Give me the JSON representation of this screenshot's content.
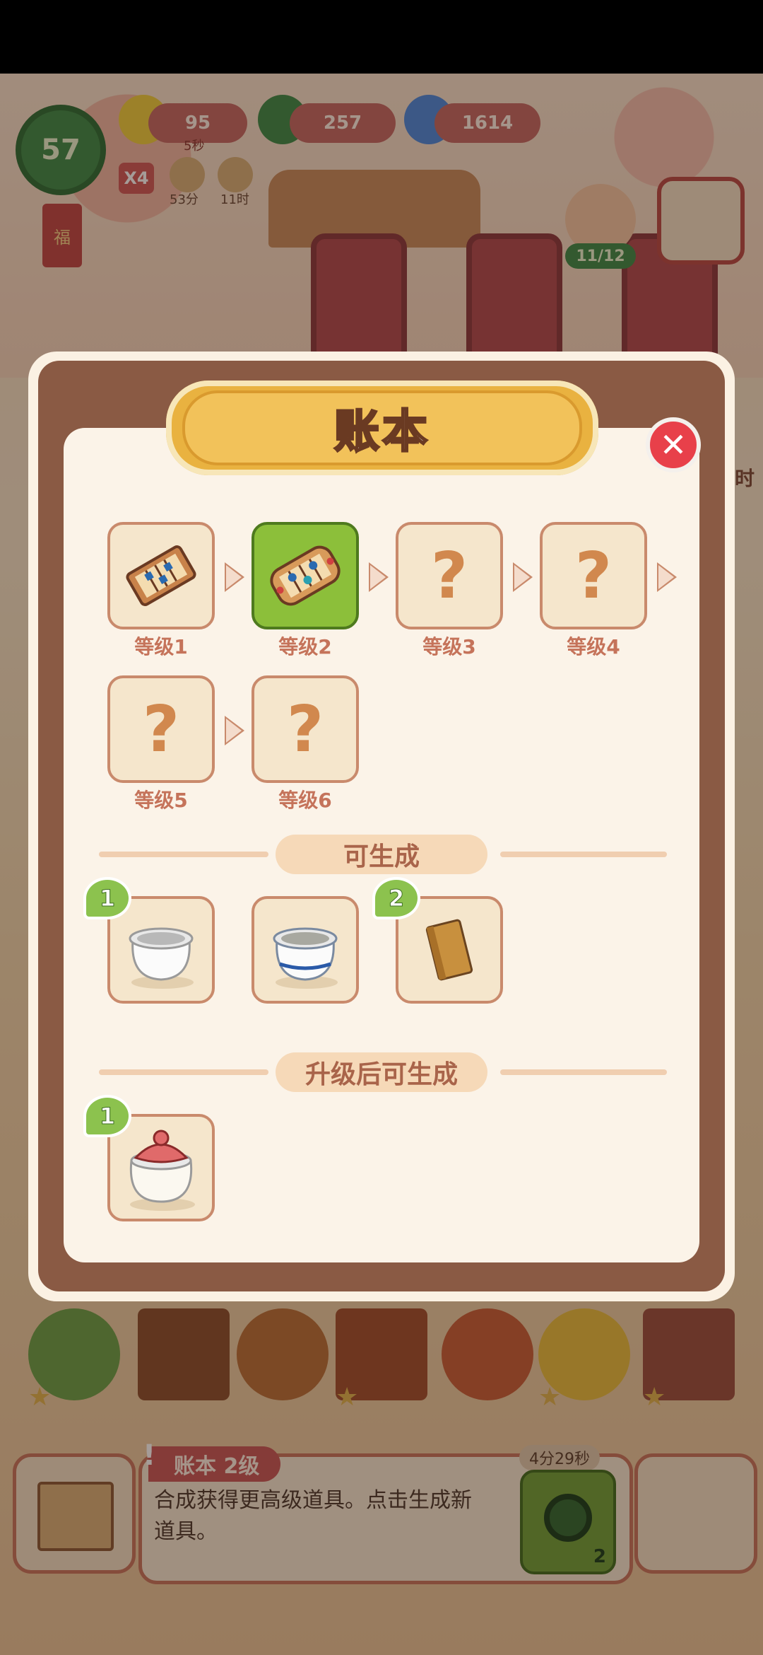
{
  "hud": {
    "player_level": "57",
    "energy": "95",
    "energy_timer": "5秒",
    "coins": "257",
    "gems": "1614",
    "multiplier": "X4",
    "timer_a": "53分",
    "timer_b": "11时",
    "npc_progress": "11/12",
    "side_clock": "时"
  },
  "dialog": {
    "title": "账本",
    "close_icon": "close-x-icon",
    "levels": [
      {
        "label": "等级1",
        "state": "unlocked",
        "icon": "abacus-icon"
      },
      {
        "label": "等级2",
        "state": "current",
        "icon": "abacus-icon"
      },
      {
        "label": "等级3",
        "state": "locked",
        "icon": "question-mark-icon",
        "mark": "?"
      },
      {
        "label": "等级4",
        "state": "locked",
        "icon": "question-mark-icon",
        "mark": "?"
      },
      {
        "label": "等级5",
        "state": "locked",
        "icon": "question-mark-icon",
        "mark": "?"
      },
      {
        "label": "等级6",
        "state": "locked",
        "icon": "question-mark-icon",
        "mark": "?"
      }
    ],
    "can_generate": {
      "title": "可生成",
      "items": [
        {
          "icon": "white-pot-icon",
          "badge": "1"
        },
        {
          "icon": "blue-rim-pot-icon",
          "badge": ""
        },
        {
          "icon": "wood-block-icon",
          "badge": "2"
        }
      ]
    },
    "after_upgrade": {
      "title": "升级后可生成",
      "items": [
        {
          "icon": "sealed-jar-icon",
          "badge": "1"
        }
      ]
    }
  },
  "bottom": {
    "item_title": "账本 2级",
    "item_desc": "合成获得更高级道具。点击生成新道具。",
    "generate_timer": "4分29秒",
    "generate_count": "2"
  },
  "colors": {
    "dialog_frame": "#8a5a44",
    "title_banner": "#f2c25a",
    "active_level": "#8cbf3a",
    "close_button": "#e8404a",
    "badge_green": "#8cc24e"
  }
}
